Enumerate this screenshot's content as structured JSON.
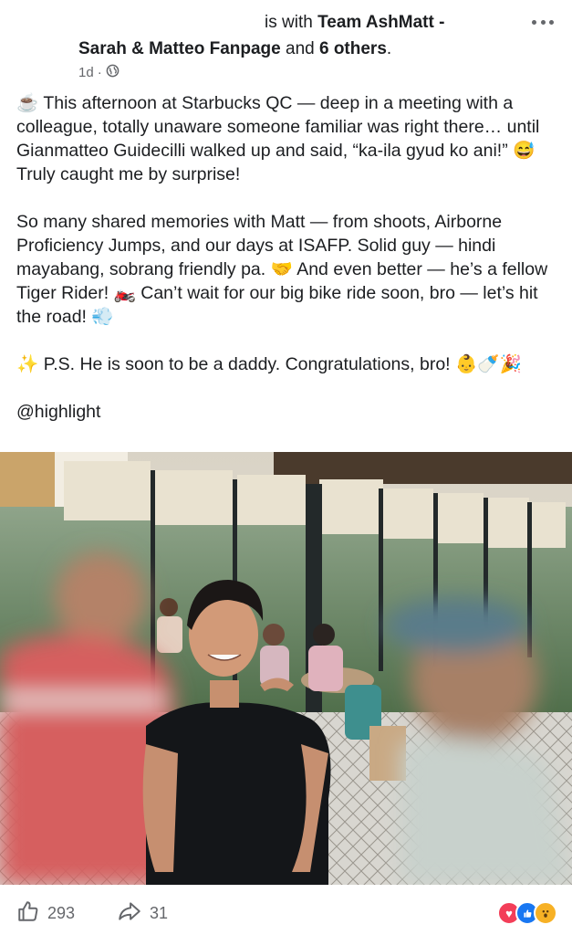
{
  "header": {
    "line1_prefix": "is with ",
    "line1_group": "Team AshMatt -",
    "line2_group": "Sarah & Matteo Fanpage",
    "line2_and": " and ",
    "line2_others": "6 others",
    "line2_period": ".",
    "time": "1d",
    "separator": "·",
    "audience_icon": "globe-icon",
    "more_icon": "more-options-icon"
  },
  "post": {
    "paragraph1": "☕ This afternoon at Starbucks QC — deep in a meeting with a colleague, totally unaware someone familiar was right there… until Gianmatteo Guidecilli walked up and said, “ka-ila gyud ko ani!” 😅 Truly caught me by surprise!",
    "paragraph2": "So many shared memories with Matt — from shoots, Airborne Proficiency Jumps, and our days at ISAFP. Solid guy — hindi mayabang, sobrang friendly pa. 🤝 And even better — he’s a fellow Tiger Rider! 🏍️ Can’t wait for our big bike ride soon, bro — let’s hit the road! 💨",
    "paragraph3": "✨ P.S. He is soon to be a daddy. Congratulations, bro! 👶🍼🎉",
    "highlight": "@highlight"
  },
  "footer": {
    "likes": "293",
    "shares": "31",
    "like_icon": "thumbs-up-icon",
    "share_icon": "share-arrow-icon",
    "reaction_icons": [
      "love-icon",
      "like-icon",
      "wow-icon"
    ]
  },
  "colors": {
    "text": "#1c1e21",
    "muted": "#65676b",
    "love": "#f33e58",
    "like": "#1877f2",
    "wow": "#f7b125"
  }
}
